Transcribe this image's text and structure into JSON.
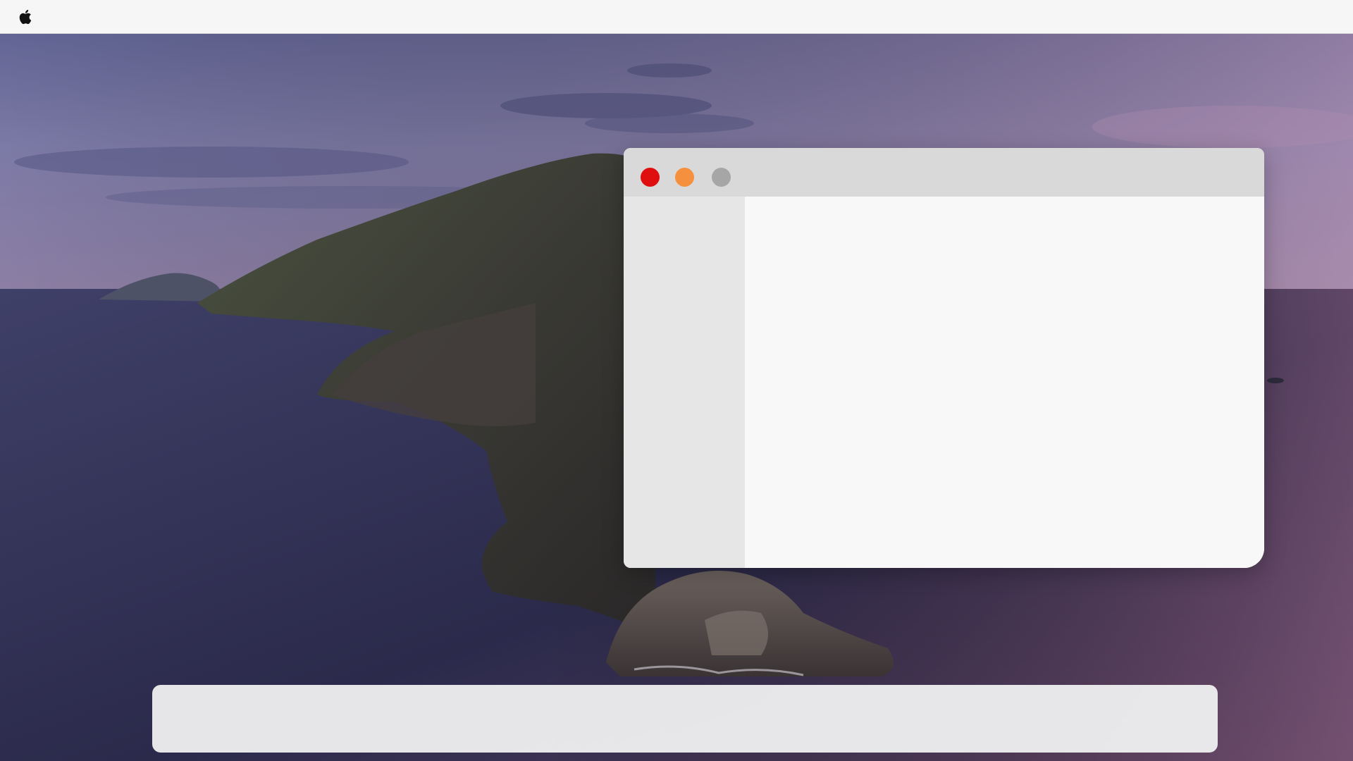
{
  "menubar": {
    "apple_icon": "apple-logo-icon"
  },
  "window": {
    "buttons": [
      {
        "name": "close",
        "color": "#e00f0f"
      },
      {
        "name": "minimize",
        "color": "#f5913e"
      },
      {
        "name": "zoom",
        "color": "#a6a6a6"
      }
    ],
    "titlebar_color": "#d9d9d9",
    "sidebar_color": "#e6e6e6",
    "content_color": "#f8f8f8"
  },
  "dock": {
    "color": "#ececee"
  }
}
